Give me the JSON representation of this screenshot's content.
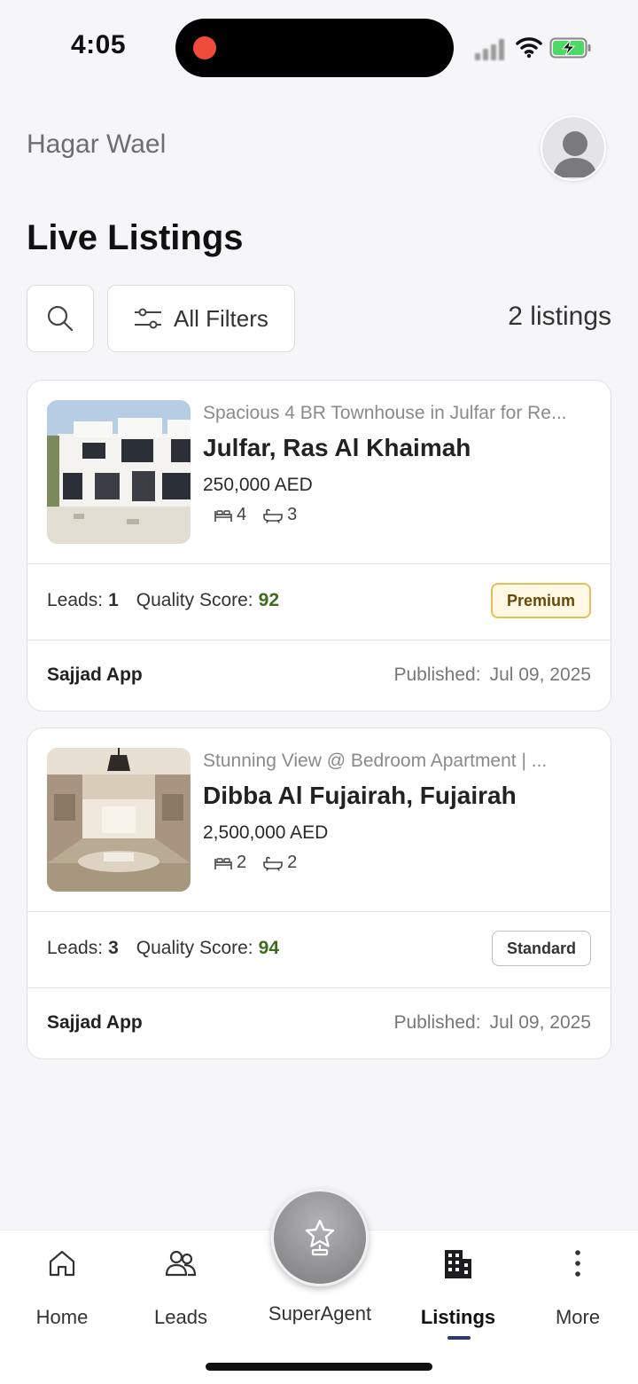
{
  "status_bar": {
    "time": "4:05"
  },
  "header": {
    "user_name": "Hagar Wael",
    "title": "Live Listings"
  },
  "toolbar": {
    "filters_label": "All Filters",
    "listings_count": "2 listings"
  },
  "listings": [
    {
      "subtitle": "Spacious 4 BR Townhouse in Julfar for Re...",
      "location": "Julfar, Ras Al Khaimah",
      "price": "250,000 AED",
      "bedrooms": "4",
      "bathrooms": "3",
      "leads_label": "Leads:",
      "leads": "1",
      "score_label": "Quality Score:",
      "score": "92",
      "tier": "Premium",
      "agent": "Sajjad App",
      "published_label": "Published:",
      "published_date": "Jul 09, 2025"
    },
    {
      "subtitle": "Stunning View @ Bedroom Apartment | ...",
      "location": "Dibba Al Fujairah, Fujairah",
      "price": "2,500,000 AED",
      "bedrooms": "2",
      "bathrooms": "2",
      "leads_label": "Leads:",
      "leads": "3",
      "score_label": "Quality Score:",
      "score": "94",
      "tier": "Standard",
      "agent": "Sajjad App",
      "published_label": "Published:",
      "published_date": "Jul 09, 2025"
    }
  ],
  "nav": {
    "home": "Home",
    "leads": "Leads",
    "superagent": "SuperAgent",
    "listings": "Listings",
    "more": "More",
    "active": "listings"
  },
  "colors": {
    "score_green": "#3d6b1f",
    "premium_border": "#e5bd5a",
    "active_indicator": "#2d3a6b"
  }
}
